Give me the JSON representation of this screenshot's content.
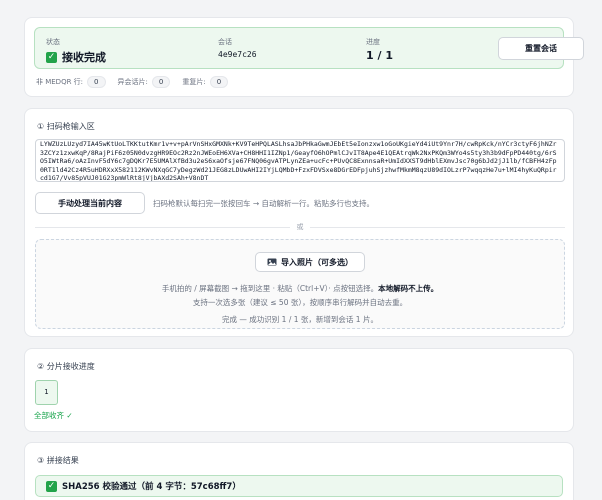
{
  "status": {
    "label": "状态",
    "value": "接收完成",
    "session_label": "会话",
    "session_id": "4e9e7c26",
    "progress_label": "进度",
    "progress_value": "1 / 1",
    "reset_button": "重置会话"
  },
  "stats": [
    {
      "label": "非 MEDQR 行:",
      "value": "0"
    },
    {
      "label": "异会话片:",
      "value": "0"
    },
    {
      "label": "重复片:",
      "value": "0"
    }
  ],
  "scanner": {
    "title": "① 扫码枪输入区",
    "text": "LYWZUzLUzyd7IA45wKtUoLTKKtutKmr1v+v+pArVnSHxGMXNk+KV9TeHPQLASLhsaJbPHkaGwmJEbEt5eIonzxw1oGoUKgieYd4iUt9Ynr7H/cwRpKck/nYCr3ctyF6jhNZr3ZCYz1zxwKqP/8RajPiF6z05N0dvzgHR9EOc2Rz2nJWEoEH6XVa+CH8HHI1IZNp1/GeayfO6hOPmlCJvIT8Ape4E1QEAtrqWk2NxPKQm3WYo4s5ty3h3b9dFpPD440tg/6rSO5IWtRa6/oAzInvF5dY6c7gDQKr7E5UMAlXfBd3u2eS6xaOfsje67FNQ06gvATPLynZEa+ucFc+PUvQC8ExnnsaR+UmIdXXST9dHblEXmvJsc70g6bJd2jJ1lb/fCBFH4zFp0RT1ld42Cz4R5uHDRXxX582112KWvNXqGC7yDegzWd21JEG8zLDUwAHI2IYjLQMbD+FzxFDVSxe8DGrEDFpjuhSjzhwfMkmM8qzU89dIOLzrP7wqqzHe7u+lMI4hyKuQRpircd1G7/Vv85pVUJ01G23pmWlRt8jVjbAXd2SAh+V8nDT",
    "process_button": "手动处理当前内容",
    "hint": "扫码枪默认每扫完一张按回车 → 自动解析一行。粘贴多行也支持。",
    "or": "或"
  },
  "dropzone": {
    "import_button": "导入照片（可多选）",
    "line1_a": "手机拍的 / 屏幕截图 → 拖到这里 · 粘贴（Ctrl+V）· 点按钮选择。",
    "line1_b": "本地解码不上传。",
    "line2": "支持一次选多张（建议 ≤ 50 张），按顺序串行解码并自动去重。",
    "line3": "完成 — 成功识别 1 / 1 张，新增到会话 1 片。"
  },
  "chunks": {
    "title": "② 分片接收进度",
    "cells": [
      "1"
    ],
    "all_received": "全部收齐 ✓"
  },
  "result": {
    "title": "③ 拼接结果",
    "sha": "SHA256 校验通过（前 4 字节：57c68ff7）"
  },
  "colors": {
    "success_bg": "#edf8ef",
    "success_border": "#b7e1c1",
    "success_check": "#22a34a"
  },
  "icons": {
    "status_check": "check-box-icon",
    "photo": "image-icon",
    "sha_check": "check-box-icon"
  }
}
